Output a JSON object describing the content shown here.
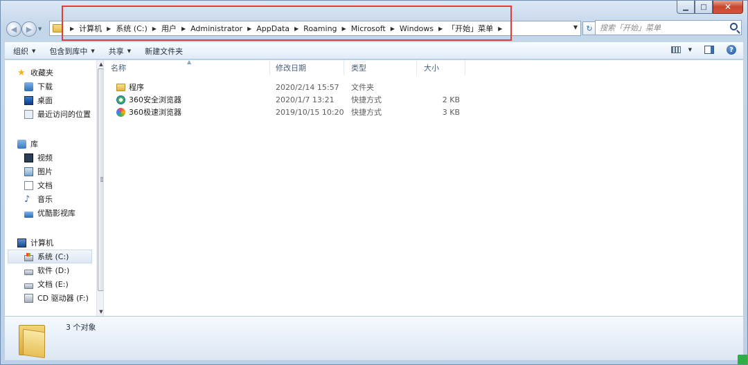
{
  "address": {
    "crumbs": [
      "计算机",
      "系统 (C:)",
      "用户",
      "Administrator",
      "AppData",
      "Roaming",
      "Microsoft",
      "Windows",
      "「开始」菜单"
    ]
  },
  "search": {
    "placeholder": "搜索「开始」菜单"
  },
  "toolbar": {
    "organize": "组织",
    "include_in_library": "包含到库中",
    "share": "共享",
    "new_folder": "新建文件夹"
  },
  "sidebar": {
    "favorites": {
      "label": "收藏夹",
      "items": [
        "下载",
        "桌面",
        "最近访问的位置"
      ]
    },
    "libraries": {
      "label": "库",
      "items": [
        "视频",
        "图片",
        "文档",
        "音乐",
        "优酷影视库"
      ]
    },
    "computer": {
      "label": "计算机",
      "items": [
        "系统 (C:)",
        "软件 (D:)",
        "文档 (E:)",
        "CD 驱动器 (F:)"
      ]
    }
  },
  "columns": {
    "name": "名称",
    "date": "修改日期",
    "type": "类型",
    "size": "大小"
  },
  "files": [
    {
      "name": "程序",
      "date": "2020/2/14 15:57",
      "type": "文件夹",
      "size": "",
      "icon": "folder-icon"
    },
    {
      "name": "360安全浏览器",
      "date": "2020/1/7 13:21",
      "type": "快捷方式",
      "size": "2 KB",
      "icon": "browser-360-icon"
    },
    {
      "name": "360极速浏览器",
      "date": "2019/10/15 10:20",
      "type": "快捷方式",
      "size": "3 KB",
      "icon": "browser-360x-icon"
    }
  ],
  "status": {
    "item_count": "3 个对象"
  },
  "colors": {
    "highlight_box": "#e23b3b",
    "window_frame": "#b9d1ea"
  }
}
